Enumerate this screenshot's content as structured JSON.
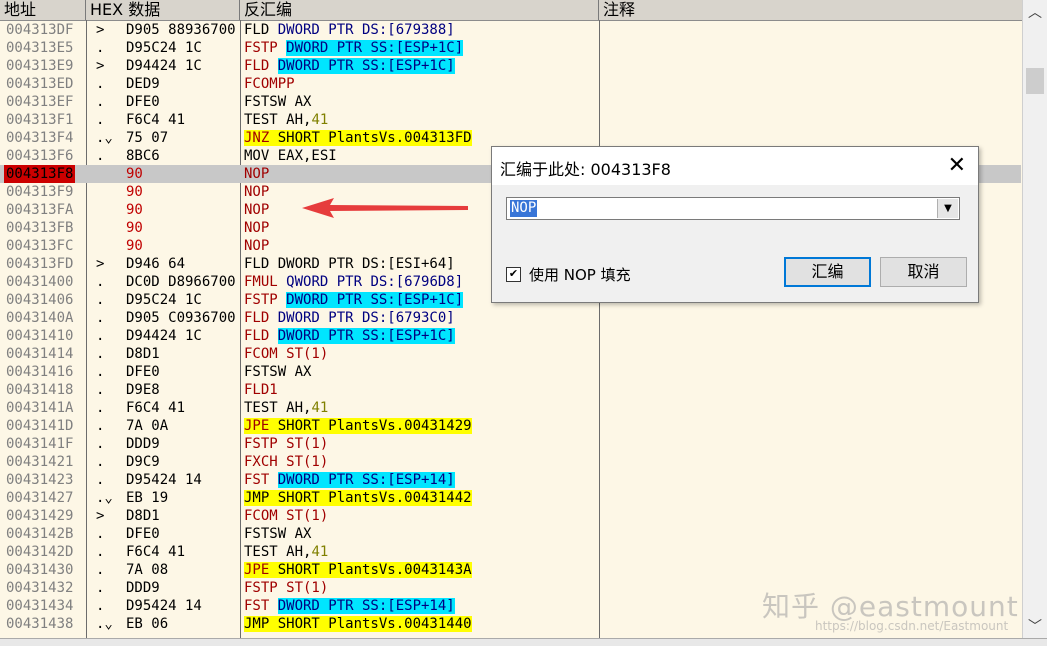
{
  "headers": {
    "address": "地址",
    "hex": "HEX 数据",
    "disasm": "反汇编",
    "comment": "注释"
  },
  "rows": [
    {
      "addr": "004313DF",
      "mark": ">",
      "hex": "D905 88936700",
      "parts": [
        [
          "FLD ",
          "k"
        ],
        [
          "DWORD PTR DS:[679388]",
          "navy"
        ]
      ]
    },
    {
      "addr": "004313E5",
      "mark": ".",
      "hex": "D95C24 1C",
      "parts": [
        [
          "FSTP ",
          "r"
        ],
        [
          "DWORD PTR SS:[ESP+1C]",
          "cyan"
        ]
      ]
    },
    {
      "addr": "004313E9",
      "mark": ">",
      "hex": "D94424 1C",
      "parts": [
        [
          "FLD ",
          "r"
        ],
        [
          "DWORD PTR SS:[ESP+1C]",
          "cyan"
        ]
      ]
    },
    {
      "addr": "004313ED",
      "mark": ".",
      "hex": "DED9",
      "parts": [
        [
          "FCOMPP",
          "r"
        ]
      ]
    },
    {
      "addr": "004313EF",
      "mark": ".",
      "hex": "DFE0",
      "parts": [
        [
          "FSTSW AX",
          "k"
        ]
      ]
    },
    {
      "addr": "004313F1",
      "mark": ".",
      "hex": "F6C4 41",
      "parts": [
        [
          "TEST AH,",
          "k"
        ],
        [
          "41",
          "olive"
        ]
      ]
    },
    {
      "addr": "004313F4",
      "mark": ".⌄",
      "hex": "75 07",
      "parts": [
        [
          "JNZ",
          "yel"
        ],
        [
          " SHORT PlantsVs.004313FD",
          "yelk"
        ]
      ]
    },
    {
      "addr": "004313F6",
      "mark": ".",
      "hex": "8BC6",
      "parts": [
        [
          "MOV EAX,ESI",
          "k"
        ]
      ]
    },
    {
      "addr": "004313F8",
      "mark": "",
      "hex": "90",
      "hexred": true,
      "sel": true,
      "parts": [
        [
          "NOP",
          "r"
        ]
      ]
    },
    {
      "addr": "004313F9",
      "mark": "",
      "hex": "90",
      "hexred": true,
      "parts": [
        [
          "NOP",
          "r"
        ]
      ]
    },
    {
      "addr": "004313FA",
      "mark": "",
      "hex": "90",
      "hexred": true,
      "parts": [
        [
          "NOP",
          "r"
        ]
      ]
    },
    {
      "addr": "004313FB",
      "mark": "",
      "hex": "90",
      "hexred": true,
      "parts": [
        [
          "NOP",
          "r"
        ]
      ]
    },
    {
      "addr": "004313FC",
      "mark": "",
      "hex": "90",
      "hexred": true,
      "parts": [
        [
          "NOP",
          "r"
        ]
      ]
    },
    {
      "addr": "004313FD",
      "mark": ">",
      "hex": "D946 64",
      "parts": [
        [
          "FLD DWORD PTR DS:[ESI+64]",
          "k"
        ]
      ]
    },
    {
      "addr": "00431400",
      "mark": ".",
      "hex": "DC0D D8966700",
      "parts": [
        [
          "FMUL ",
          "r"
        ],
        [
          "QWORD PTR DS:[6796D8]",
          "navy"
        ]
      ]
    },
    {
      "addr": "00431406",
      "mark": ".",
      "hex": "D95C24 1C",
      "parts": [
        [
          "FSTP ",
          "r"
        ],
        [
          "DWORD PTR SS:[ESP+1C]",
          "cyan"
        ]
      ]
    },
    {
      "addr": "0043140A",
      "mark": ".",
      "hex": "D905 C0936700",
      "parts": [
        [
          "FLD ",
          "r"
        ],
        [
          "DWORD PTR DS:[6793C0]",
          "navy"
        ]
      ]
    },
    {
      "addr": "00431410",
      "mark": ".",
      "hex": "D94424 1C",
      "parts": [
        [
          "FLD ",
          "r"
        ],
        [
          "DWORD PTR SS:[ESP+1C]",
          "cyan"
        ]
      ]
    },
    {
      "addr": "00431414",
      "mark": ".",
      "hex": "D8D1",
      "parts": [
        [
          "FCOM ST(1)",
          "r"
        ]
      ]
    },
    {
      "addr": "00431416",
      "mark": ".",
      "hex": "DFE0",
      "parts": [
        [
          "FSTSW AX",
          "k"
        ]
      ]
    },
    {
      "addr": "00431418",
      "mark": ".",
      "hex": "D9E8",
      "parts": [
        [
          "FLD1",
          "r"
        ]
      ]
    },
    {
      "addr": "0043141A",
      "mark": ".",
      "hex": "F6C4 41",
      "parts": [
        [
          "TEST AH,",
          "k"
        ],
        [
          "41",
          "olive"
        ]
      ]
    },
    {
      "addr": "0043141D",
      "mark": ".",
      "hex": "7A 0A",
      "parts": [
        [
          "JPE",
          "yel"
        ],
        [
          " SHORT PlantsVs.00431429",
          "yelk"
        ]
      ]
    },
    {
      "addr": "0043141F",
      "mark": ".",
      "hex": "DDD9",
      "parts": [
        [
          "FSTP ST(1)",
          "r"
        ]
      ]
    },
    {
      "addr": "00431421",
      "mark": ".",
      "hex": "D9C9",
      "parts": [
        [
          "FXCH ST(1)",
          "r"
        ]
      ]
    },
    {
      "addr": "00431423",
      "mark": ".",
      "hex": "D95424 14",
      "parts": [
        [
          "FST ",
          "r"
        ],
        [
          "DWORD PTR SS:[ESP+14]",
          "cyan"
        ]
      ]
    },
    {
      "addr": "00431427",
      "mark": ".⌄",
      "hex": "EB 19",
      "parts": [
        [
          "JMP SHORT PlantsVs.00431442",
          "yelk"
        ]
      ]
    },
    {
      "addr": "00431429",
      "mark": ">",
      "hex": "D8D1",
      "parts": [
        [
          "FCOM ST(1)",
          "r"
        ]
      ]
    },
    {
      "addr": "0043142B",
      "mark": ".",
      "hex": "DFE0",
      "parts": [
        [
          "FSTSW AX",
          "k"
        ]
      ]
    },
    {
      "addr": "0043142D",
      "mark": ".",
      "hex": "F6C4 41",
      "parts": [
        [
          "TEST AH,",
          "k"
        ],
        [
          "41",
          "olive"
        ]
      ]
    },
    {
      "addr": "00431430",
      "mark": ".",
      "hex": "7A 08",
      "parts": [
        [
          "JPE",
          "yel"
        ],
        [
          " SHORT PlantsVs.0043143A",
          "yelk"
        ]
      ]
    },
    {
      "addr": "00431432",
      "mark": ".",
      "hex": "DDD9",
      "parts": [
        [
          "FSTP ST(1)",
          "r"
        ]
      ]
    },
    {
      "addr": "00431434",
      "mark": ".",
      "hex": "D95424 14",
      "parts": [
        [
          "FST ",
          "r"
        ],
        [
          "DWORD PTR SS:[ESP+14]",
          "cyan"
        ]
      ]
    },
    {
      "addr": "00431438",
      "mark": ".⌄",
      "hex": "EB 06",
      "parts": [
        [
          "JMP SHORT PlantsVs.00431440",
          "yelk"
        ]
      ]
    }
  ],
  "dialog": {
    "title": "汇编于此处: 004313F8",
    "input_value": "NOP",
    "checkbox_label": "使用 NOP 填充",
    "checkbox_checked": true,
    "ok_label": "汇编",
    "cancel_label": "取消"
  },
  "watermark": "知乎 @eastmount",
  "watermark_url": "https://blog.csdn.net/Eastmount"
}
